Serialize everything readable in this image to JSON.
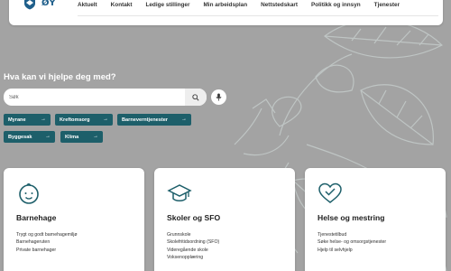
{
  "header": {
    "logo_text": "ØY",
    "nav": [
      "Aktuelt",
      "Kontakt",
      "Ledige stillinger",
      "Min arbeidsplan",
      "Nettstedskart",
      "Politikk og innsyn",
      "Tjenester"
    ]
  },
  "hero": {
    "title": "Hva kan vi hjelpe deg med?",
    "search_placeholder": "Søk",
    "chips": [
      {
        "label": "Myrane"
      },
      {
        "label": "Kreftomsorg"
      },
      {
        "label": "Barneverntjenester"
      },
      {
        "label": "Byggesak"
      },
      {
        "label": "Klima"
      }
    ]
  },
  "cards": [
    {
      "title": "Barnehage",
      "icon": "baby-face-icon",
      "links": [
        "Trygt og godt barnehagemiljø",
        "Barnehageruten",
        "Private barnehager"
      ]
    },
    {
      "title": "Skoler og SFO",
      "icon": "graduation-cap-icon",
      "links": [
        "Grunnskole",
        "Skolefritidsordning (SFO)",
        "Videregående skole",
        "Voksenopplæring"
      ]
    },
    {
      "title": "Helse og mestring",
      "icon": "heart-icon",
      "links": [
        "Tjenestetilbud",
        "Søke helse- og omsorgstjenester",
        "Hjelp til selvhjelp"
      ]
    }
  ],
  "colors": {
    "hero_bg": "#a3a3a3",
    "chip_bg": "#1d5f6a",
    "icon_teal": "#1d5f6a",
    "logo_blue": "#1f5f8b"
  }
}
